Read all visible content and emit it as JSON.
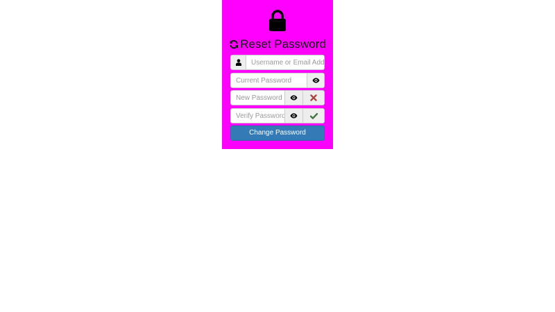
{
  "header": {
    "lock_icon": "lock-icon",
    "refresh_icon": "refresh-icon",
    "title": "Reset Password"
  },
  "form": {
    "username": {
      "placeholder": "Username or Email Address",
      "value": "",
      "icon": "user-icon"
    },
    "current_password": {
      "placeholder": "Current Password",
      "value": "",
      "toggle_icon": "eye-icon"
    },
    "new_password": {
      "placeholder": "New Password",
      "value": "",
      "toggle_icon": "eye-icon",
      "status_icon": "x-mark-icon",
      "status_color": "#a94442"
    },
    "verify_password": {
      "placeholder": "Verify Password",
      "value": "",
      "toggle_icon": "eye-icon",
      "status_icon": "checkmark-icon",
      "status_color": "#3c763d"
    },
    "submit_label": "Change Password"
  },
  "colors": {
    "panel_background": "#ff00ff",
    "button_primary": "#337ab7"
  }
}
